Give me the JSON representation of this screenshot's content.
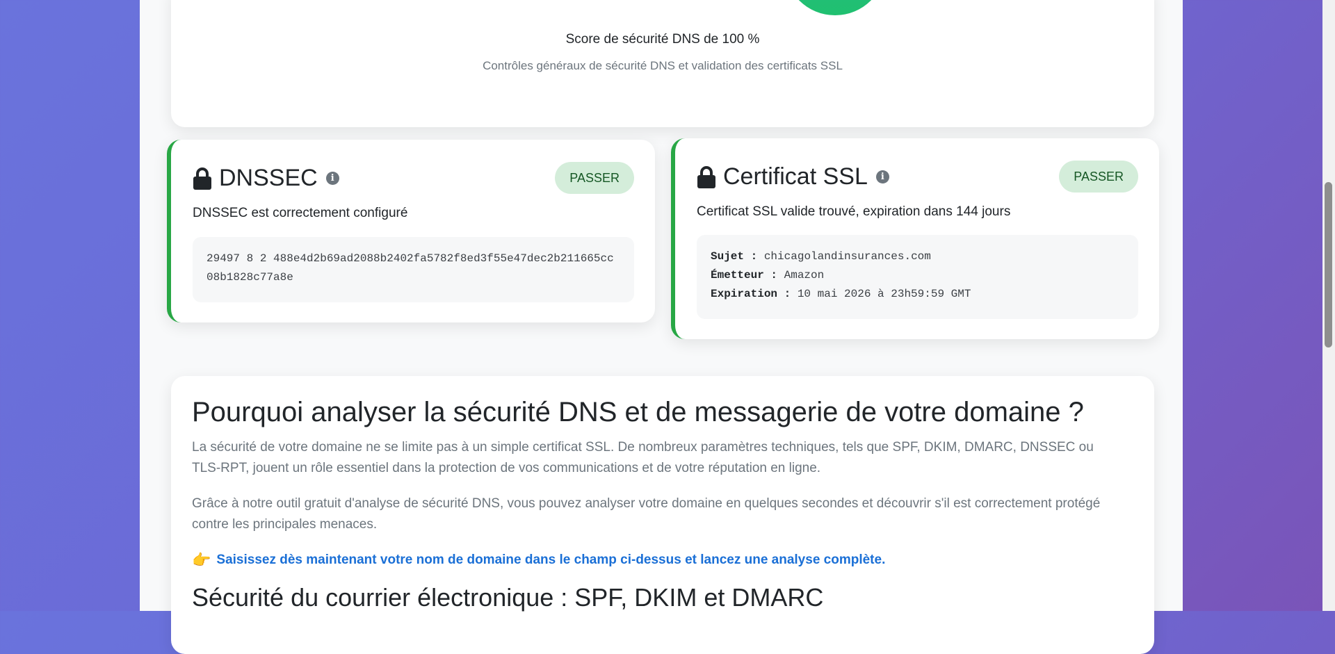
{
  "score": {
    "title": "Score de sécurité DNS de 100 %",
    "subtitle": "Contrôles généraux de sécurité DNS et validation des certificats SSL"
  },
  "dnssec": {
    "title": "DNSSEC",
    "badge": "PASSER",
    "description": "DNSSEC est correctement configuré",
    "record": "29497 8 2 488e4d2b69ad2088b2402fa5782f8ed3f55e47dec2b211665cc08b1828c77a8e"
  },
  "ssl": {
    "title": "Certificat SSL",
    "badge": "PASSER",
    "description": "Certificat SSL valide trouvé, expiration dans 144 jours",
    "subject_label": "Sujet :",
    "subject_value": "chicagolandinsurances.com",
    "issuer_label": "Émetteur :",
    "issuer_value": "Amazon",
    "expiry_label": "Expiration :",
    "expiry_value": "10 mai 2026 à 23h59:59 GMT"
  },
  "info": {
    "heading": "Pourquoi analyser la sécurité DNS et de messagerie de votre domaine ?",
    "paragraph1": "La sécurité de votre domaine ne se limite pas à un simple certificat SSL. De nombreux paramètres techniques, tels que SPF, DKIM, DMARC, DNSSEC ou TLS-RPT, jouent un rôle essentiel dans la protection de vos communications et de votre réputation en ligne.",
    "paragraph2": "Grâce à notre outil gratuit d'analyse de sécurité DNS, vous pouvez analyser votre domaine en quelques secondes et découvrir s'il est correctement protégé contre les principales menaces.",
    "cta_icon": "👉",
    "cta": "Saisissez dès maintenant votre nom de domaine dans le champ ci-dessus et lancez une analyse complète.",
    "subheading": "Sécurité du courrier électronique : SPF, DKIM et DMARC"
  },
  "colors": {
    "pass_border": "#28a745",
    "pass_badge_bg": "#d4edda",
    "pass_badge_text": "#155724",
    "link": "#1a6fd6",
    "score_circle": "#22bb7a"
  }
}
